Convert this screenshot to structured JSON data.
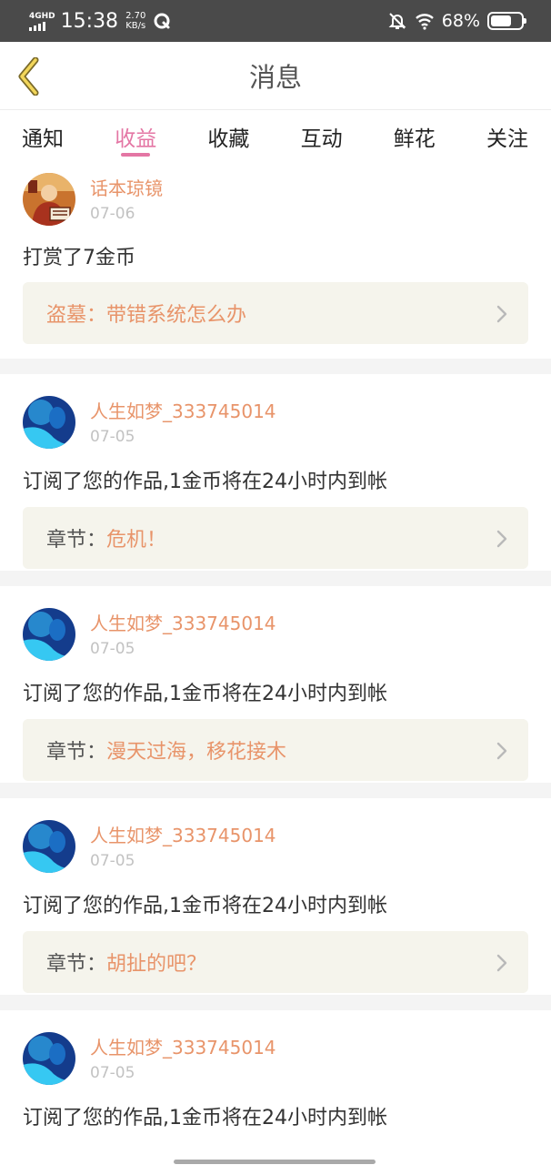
{
  "status_bar": {
    "network": "4GHD",
    "time": "15:38",
    "speed_value": "2.70",
    "speed_unit": "KB/s",
    "battery_percent": "68%",
    "battery_level": 0.68
  },
  "header": {
    "title": "消息",
    "back_icon": "chevron-left-icon"
  },
  "tabs": [
    {
      "label": "通知",
      "active": false
    },
    {
      "label": "收益",
      "active": true
    },
    {
      "label": "收藏",
      "active": false
    },
    {
      "label": "互动",
      "active": false
    },
    {
      "label": "鲜花",
      "active": false
    },
    {
      "label": "关注",
      "active": false
    }
  ],
  "colors": {
    "accent": "#e476a4",
    "name_orange": "#e8946a",
    "ref_bg": "#f5f4ec",
    "status_bar_bg": "#4a4a4a"
  },
  "messages": [
    {
      "username": "话本琼镜",
      "date": "07-06",
      "text": "打赏了7金币",
      "ref_label": "",
      "ref_title": "盗墓：带错系统怎么办"
    },
    {
      "username": "人生如梦_333745014",
      "date": "07-05",
      "text": "订阅了您的作品,1金币将在24小时内到帐",
      "ref_label": "章节：",
      "ref_title": "危机！"
    },
    {
      "username": "人生如梦_333745014",
      "date": "07-05",
      "text": "订阅了您的作品,1金币将在24小时内到帐",
      "ref_label": "章节：",
      "ref_title": "漫天过海，移花接木"
    },
    {
      "username": "人生如梦_333745014",
      "date": "07-05",
      "text": "订阅了您的作品,1金币将在24小时内到帐",
      "ref_label": "章节：",
      "ref_title": "胡扯的吧？"
    },
    {
      "username": "人生如梦_333745014",
      "date": "07-05",
      "text": "订阅了您的作品,1金币将在24小时内到帐",
      "ref_label": "",
      "ref_title": ""
    }
  ]
}
